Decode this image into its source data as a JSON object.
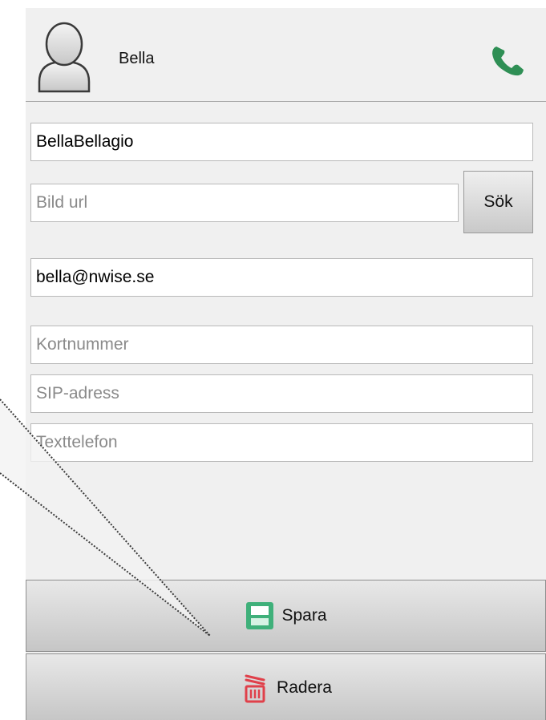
{
  "contact": {
    "name": "Bella",
    "avatar_icon": "user-silhouette-icon",
    "call_icon": "phone-icon"
  },
  "form": {
    "username": {
      "value": "BellaBellagio",
      "placeholder": ""
    },
    "image_url": {
      "value": "",
      "placeholder": "Bild url"
    },
    "search_label": "Sök",
    "email": {
      "value": "bella@nwise.se",
      "placeholder": ""
    },
    "card_number": {
      "value": "",
      "placeholder": "Kortnummer"
    },
    "sip_address": {
      "value": "",
      "placeholder": "SIP-adress"
    },
    "text_phone": {
      "value": "",
      "placeholder": "Texttelefon"
    }
  },
  "actions": {
    "save_label": "Spara",
    "save_icon": "floppy-disk-icon",
    "delete_label": "Radera",
    "delete_icon": "trash-icon"
  },
  "colors": {
    "panel_bg": "#f0f0f0",
    "call_green": "#2f8f55",
    "save_green": "#3fb07a",
    "delete_red": "#e0404a"
  }
}
